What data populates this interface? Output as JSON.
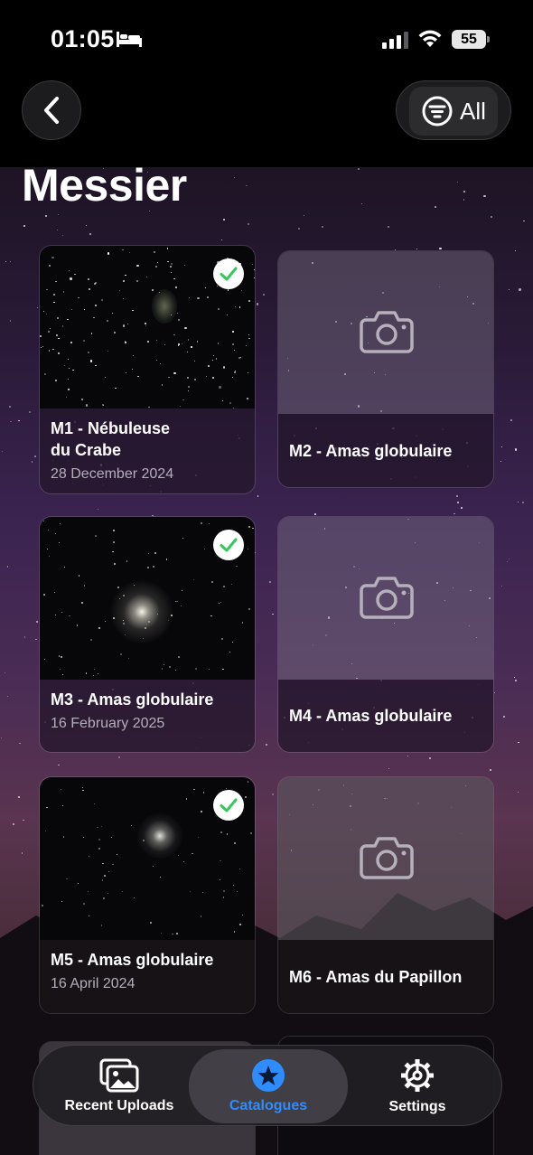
{
  "status_bar": {
    "time": "01:05",
    "battery": "55"
  },
  "header": {
    "filter_label": "All",
    "title": "Messier"
  },
  "catalogue": [
    {
      "title": "M1 - Nébuleuse du Crabe",
      "title_line1": "M1 - Nébuleuse",
      "title_line2": "du Crabe",
      "date": "28 December 2024",
      "captured": true
    },
    {
      "title": "M2 - Amas globulaire",
      "captured": false
    },
    {
      "title": "M3 - Amas globulaire",
      "date": "16 February 2025",
      "captured": true
    },
    {
      "title": "M4 - Amas globulaire",
      "captured": false
    },
    {
      "title": "M5 - Amas globulaire",
      "date": "16 April 2024",
      "captured": true
    },
    {
      "title": "M6 - Amas du Papillon",
      "captured": false
    }
  ],
  "tab_bar": {
    "items": [
      {
        "label": "Recent Uploads",
        "icon": "photos-icon"
      },
      {
        "label": "Catalogues",
        "icon": "star-icon",
        "active": true
      },
      {
        "label": "Settings",
        "icon": "gear-icon"
      }
    ]
  },
  "colors": {
    "accent": "#2f8cff",
    "check": "#34c759"
  }
}
